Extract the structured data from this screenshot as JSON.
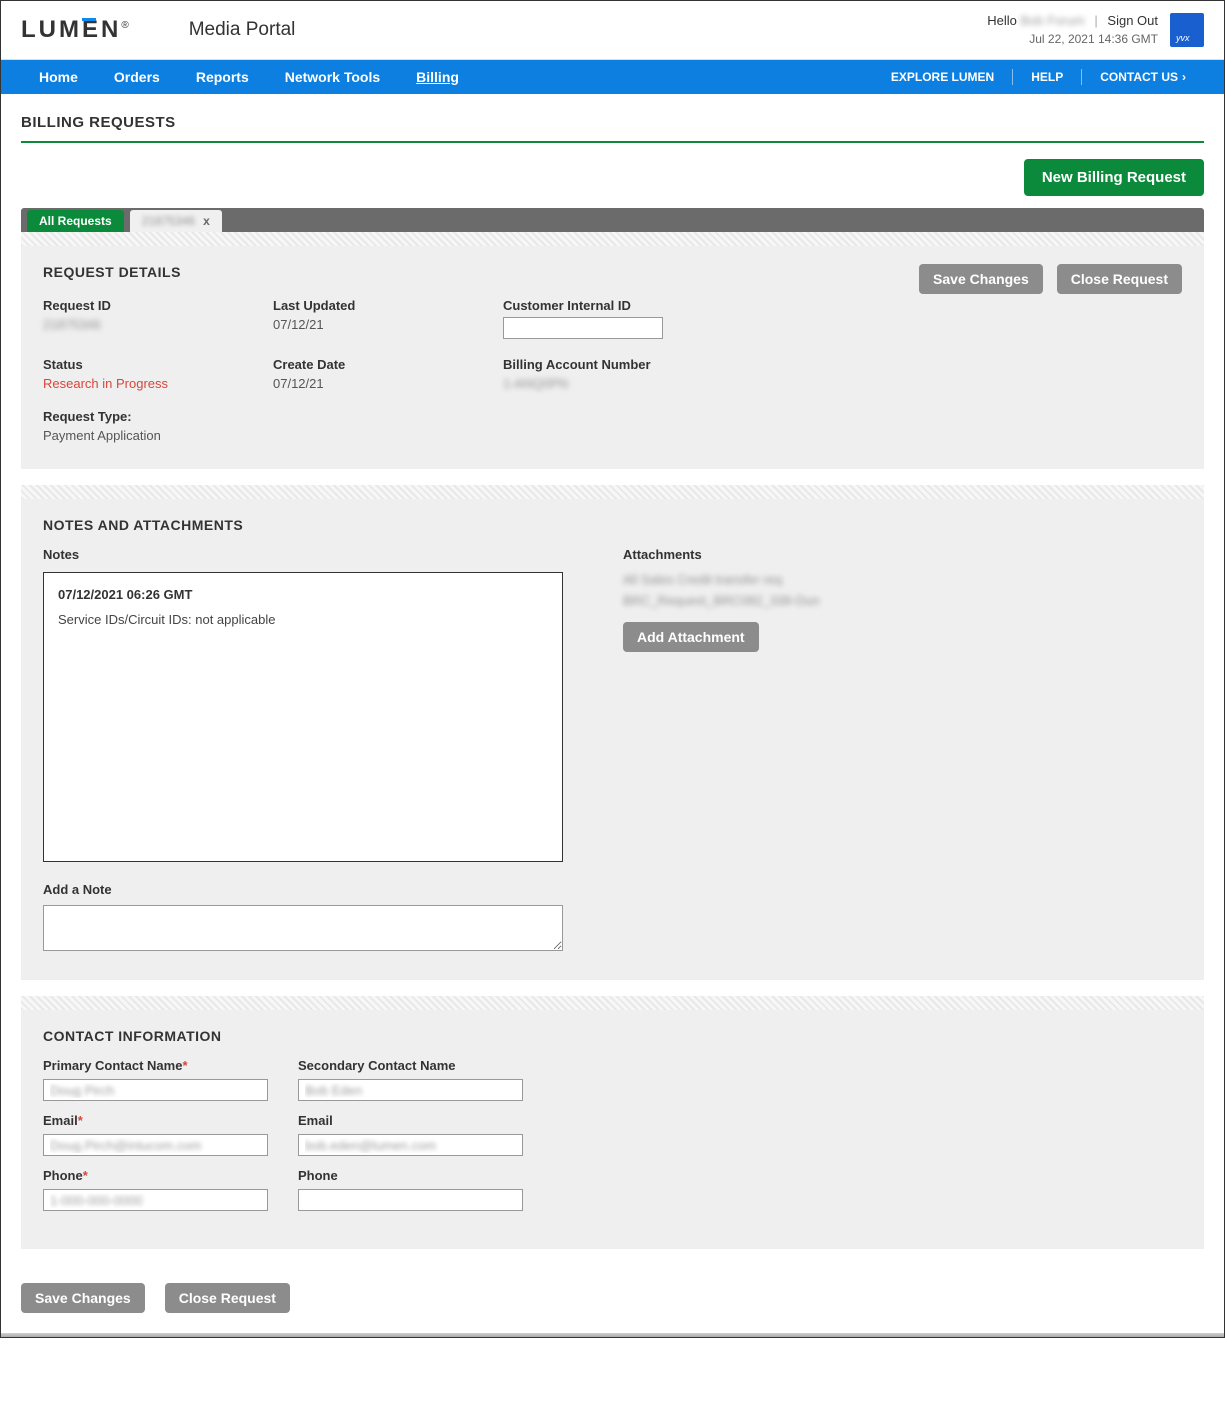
{
  "header": {
    "logo_text": "LUMEN",
    "logo_reg": "®",
    "portal_title": "Media Portal",
    "greeting_prefix": "Hello",
    "greeting_name": "Bob Forum",
    "signout": "Sign Out",
    "timestamp": "Jul 22, 2021 14:36 GMT"
  },
  "nav": {
    "items": [
      "Home",
      "Orders",
      "Reports",
      "Network Tools",
      "Billing"
    ],
    "right": [
      "EXPLORE LUMEN",
      "HELP",
      "CONTACT US"
    ]
  },
  "page": {
    "title": "BILLING REQUESTS",
    "new_request_btn": "New Billing Request"
  },
  "tabs": {
    "active": "All Requests",
    "inactive_id": "21875346",
    "close": "x"
  },
  "details": {
    "section_title": "REQUEST DETAILS",
    "save_btn": "Save Changes",
    "close_btn": "Close Request",
    "fields": {
      "request_id_label": "Request ID",
      "request_id_value": "21875346",
      "last_updated_label": "Last Updated",
      "last_updated_value": "07/12/21",
      "customer_internal_id_label": "Customer Internal ID",
      "customer_internal_id_value": "",
      "status_label": "Status",
      "status_value": "Research in Progress",
      "create_date_label": "Create Date",
      "create_date_value": "07/12/21",
      "billing_account_label": "Billing Account Number",
      "billing_account_value": "1-ANQ0PN",
      "request_type_label": "Request Type:",
      "request_type_value": "Payment Application"
    }
  },
  "notes": {
    "section_title": "NOTES AND ATTACHMENTS",
    "notes_label": "Notes",
    "note_timestamp": "07/12/2021 06:26 GMT",
    "note_body": "Service IDs/Circuit IDs: not applicable",
    "add_note_label": "Add a Note",
    "attachments_label": "Attachments",
    "attachment_items": [
      "All Sales Credit transfer req",
      "BRC_Request_BRC082_338-Dun"
    ],
    "add_attachment_btn": "Add Attachment"
  },
  "contact": {
    "section_title": "CONTACT INFORMATION",
    "primary_name_label": "Primary Contact Name",
    "primary_name_value": "Doug Pirch",
    "secondary_name_label": "Secondary Contact Name",
    "secondary_name_value": "Bob Eden",
    "email_label": "Email",
    "primary_email_value": "Doug.Pirch@intucom.com",
    "secondary_email_value": "bob.eden@lumen.com",
    "phone_label": "Phone",
    "primary_phone_value": "1-000-000-0000",
    "secondary_phone_value": ""
  },
  "footer": {
    "save_btn": "Save Changes",
    "close_btn": "Close Request"
  }
}
